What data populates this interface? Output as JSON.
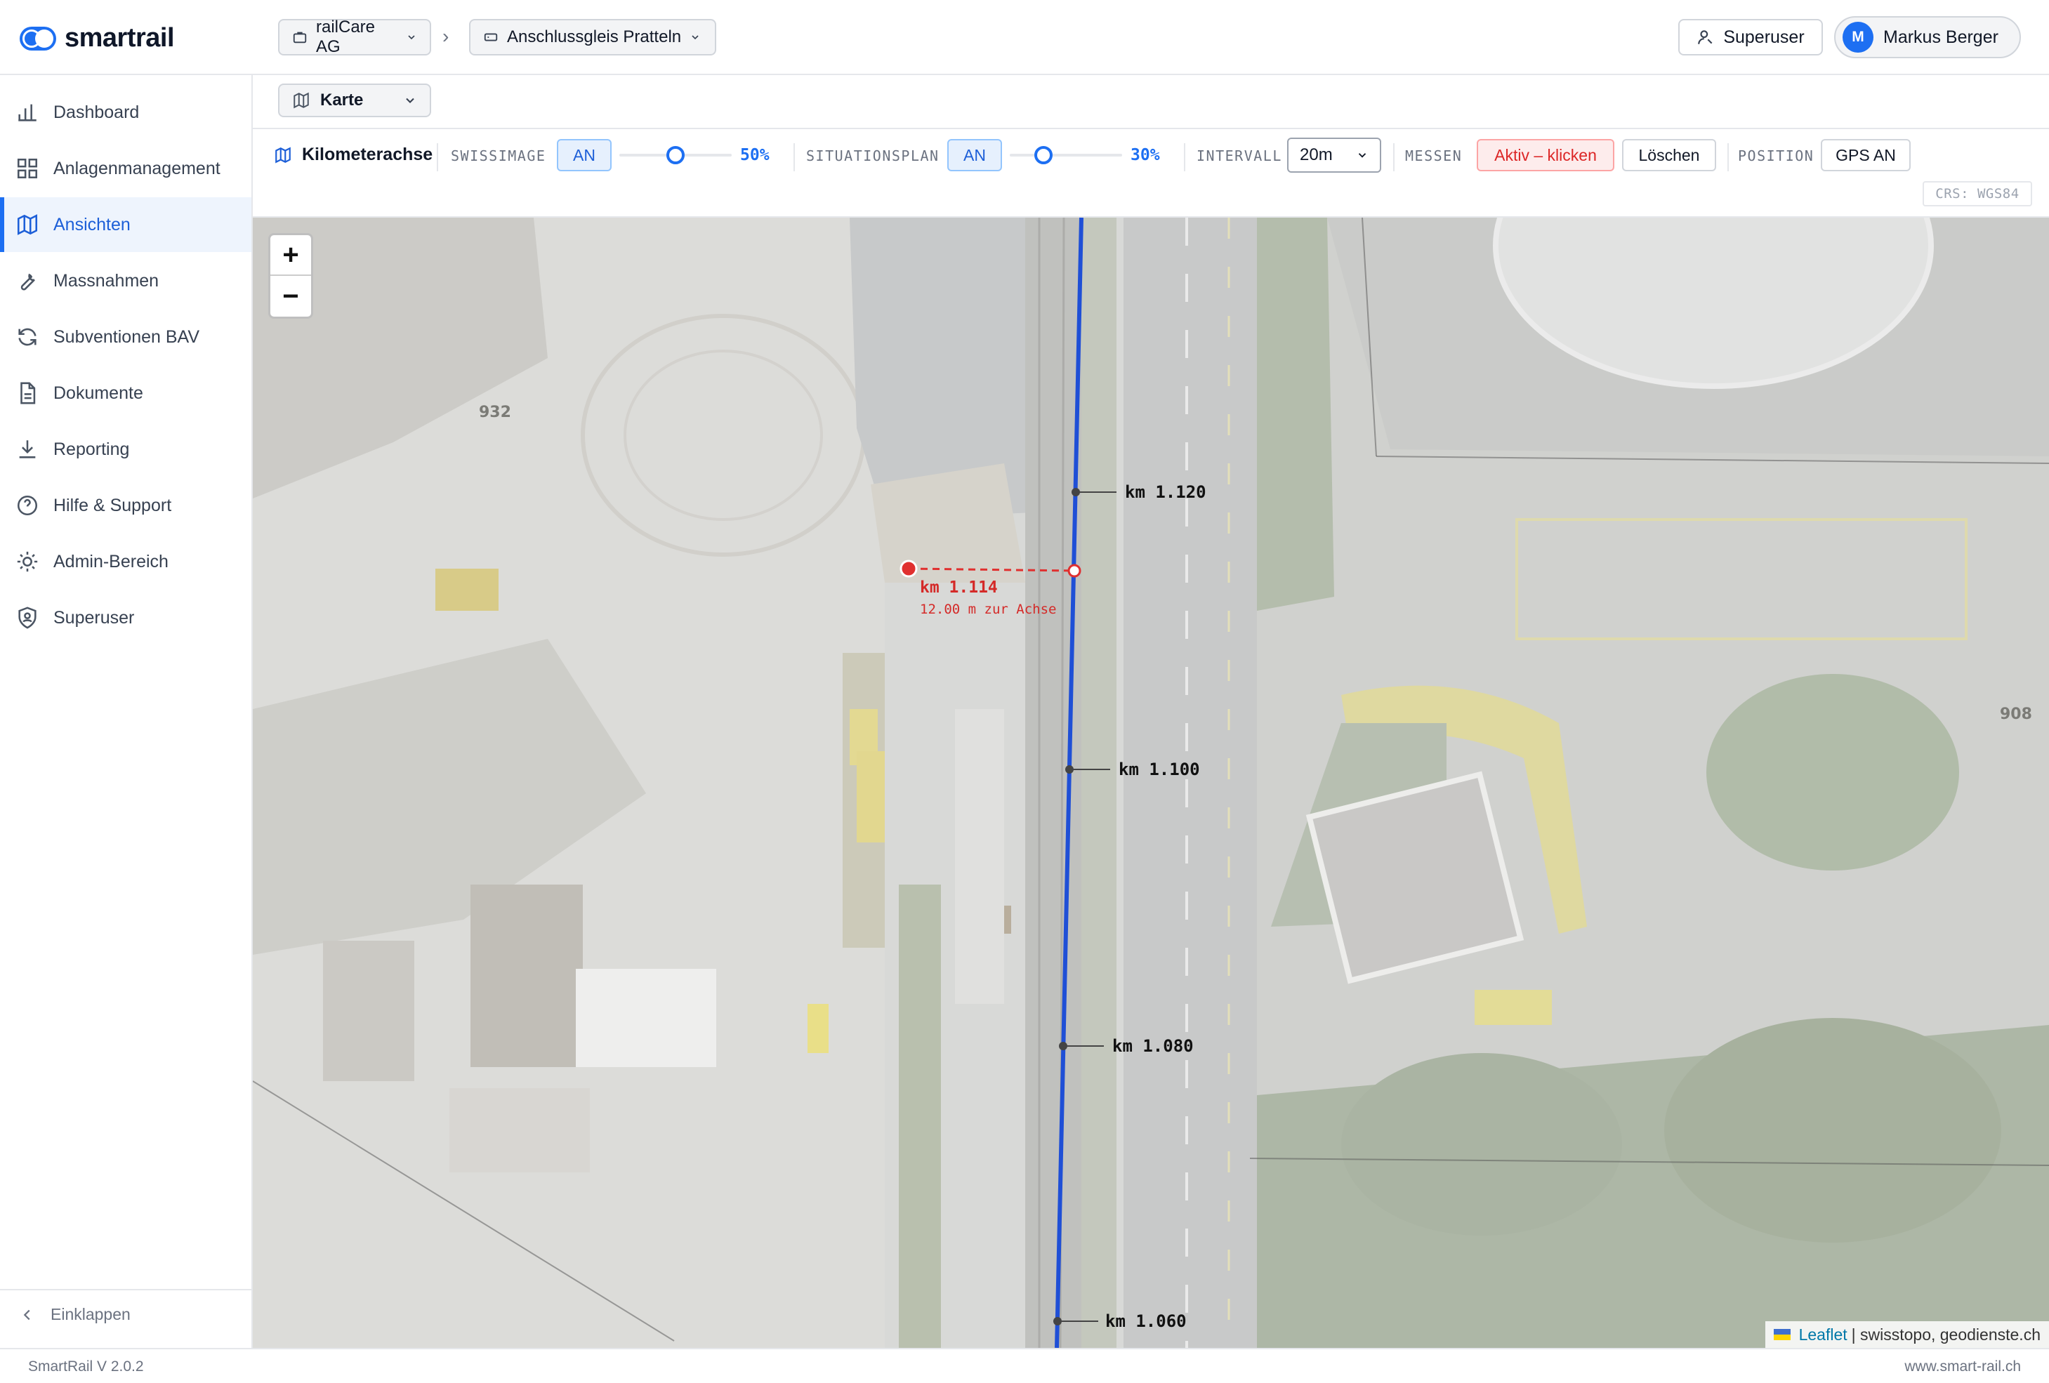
{
  "app": {
    "logo_text": "smartrail",
    "version": "SmartRail V 2.0.2",
    "website": "www.smart-rail.ch"
  },
  "header": {
    "company": "railCare AG",
    "site": "Anschlussgleis Pratteln",
    "superuser_label": "Superuser",
    "user_initial": "M",
    "user_name": "Markus Berger"
  },
  "sidebar": {
    "items": [
      {
        "label": "Dashboard",
        "icon": "bar-chart-icon"
      },
      {
        "label": "Anlagenmanagement",
        "icon": "grid-icon"
      },
      {
        "label": "Ansichten",
        "icon": "map-icon",
        "active": true
      },
      {
        "label": "Massnahmen",
        "icon": "wrench-icon"
      },
      {
        "label": "Subventionen BAV",
        "icon": "refresh-icon"
      },
      {
        "label": "Dokumente",
        "icon": "document-icon"
      },
      {
        "label": "Reporting",
        "icon": "download-icon"
      },
      {
        "label": "Hilfe & Support",
        "icon": "help-icon"
      },
      {
        "label": "Admin-Bereich",
        "icon": "sun-icon"
      },
      {
        "label": "Superuser",
        "icon": "shield-icon"
      }
    ],
    "collapse_label": "Einklappen"
  },
  "viewbar": {
    "selected_view": "Karte"
  },
  "toolbar": {
    "title": "Kilometerachse",
    "swissimage_label": "SWISSIMAGE",
    "swissimage_toggle": "AN",
    "swissimage_opacity": 50,
    "swissimage_opacity_text": "50%",
    "situationsplan_label": "SITUATIONSPLAN",
    "situationsplan_toggle": "AN",
    "situationsplan_opacity": 30,
    "situationsplan_opacity_text": "30%",
    "interval_label": "INTERVALL",
    "interval_value": "20m",
    "measure_label": "MESSEN",
    "measure_button": "Aktiv – klicken",
    "clear_button": "Löschen",
    "position_label": "POSITION",
    "gps_button": "GPS AN",
    "crs": "CRS: WGS84"
  },
  "map": {
    "zoom_in": "+",
    "zoom_out": "−",
    "km_labels": [
      "km 1.120",
      "km 1.100",
      "km 1.080",
      "km 1.060"
    ],
    "measure_km": "km 1.114",
    "measure_distance": "12.00 m zur Achse",
    "parcel_numbers": [
      "932",
      "908"
    ],
    "attribution_leaflet": "Leaflet",
    "attribution_rest": "| swisstopo, geodienste.ch",
    "colors": {
      "axis": "#1f4fd6",
      "measure": "#e0302f"
    }
  }
}
